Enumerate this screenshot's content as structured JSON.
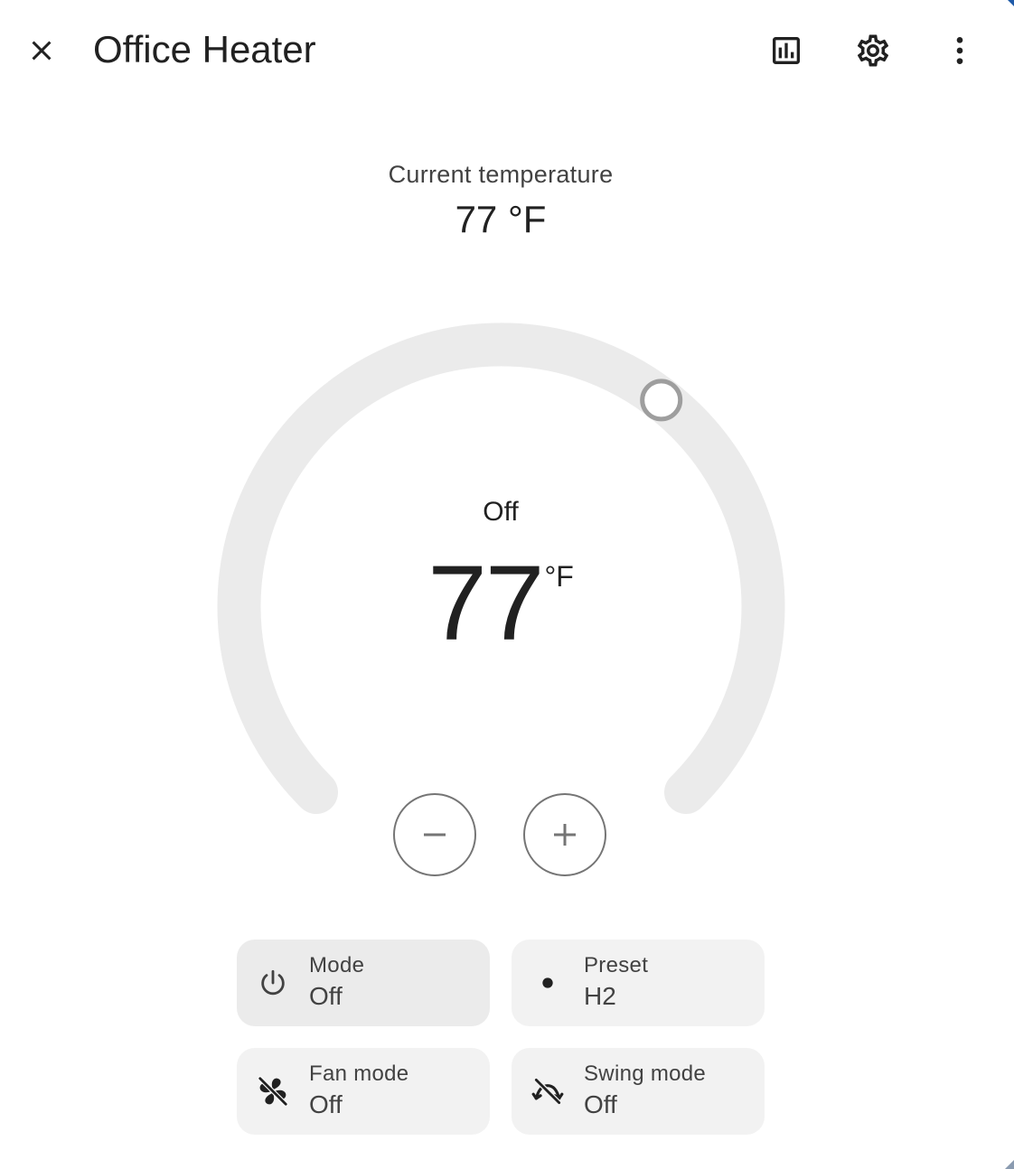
{
  "header": {
    "title": "Office Heater",
    "icons": {
      "close": "close-icon",
      "history": "chart-box-icon",
      "settings": "gear-icon",
      "more": "dots-vertical-icon"
    }
  },
  "current": {
    "label": "Current temperature",
    "value": "77 °F"
  },
  "thermostat": {
    "mode_state": "Off",
    "target_value": "77",
    "target_unit": "°F",
    "range_min": 45,
    "range_max": 95,
    "target": 77,
    "minus_icon": "minus-icon",
    "plus_icon": "plus-icon"
  },
  "features": [
    {
      "label": "Mode",
      "value": "Off",
      "icon": "power-icon"
    },
    {
      "label": "Preset",
      "value": "H2",
      "icon": "dot-icon"
    },
    {
      "label": "Fan mode",
      "value": "Off",
      "icon": "fan-off-icon"
    },
    {
      "label": "Swing mode",
      "value": "Off",
      "icon": "swing-off-icon"
    }
  ],
  "colors": {
    "track": "#ebebeb",
    "knob": "#9e9e9e",
    "tile": "#f2f2f2",
    "text": "#212121"
  }
}
